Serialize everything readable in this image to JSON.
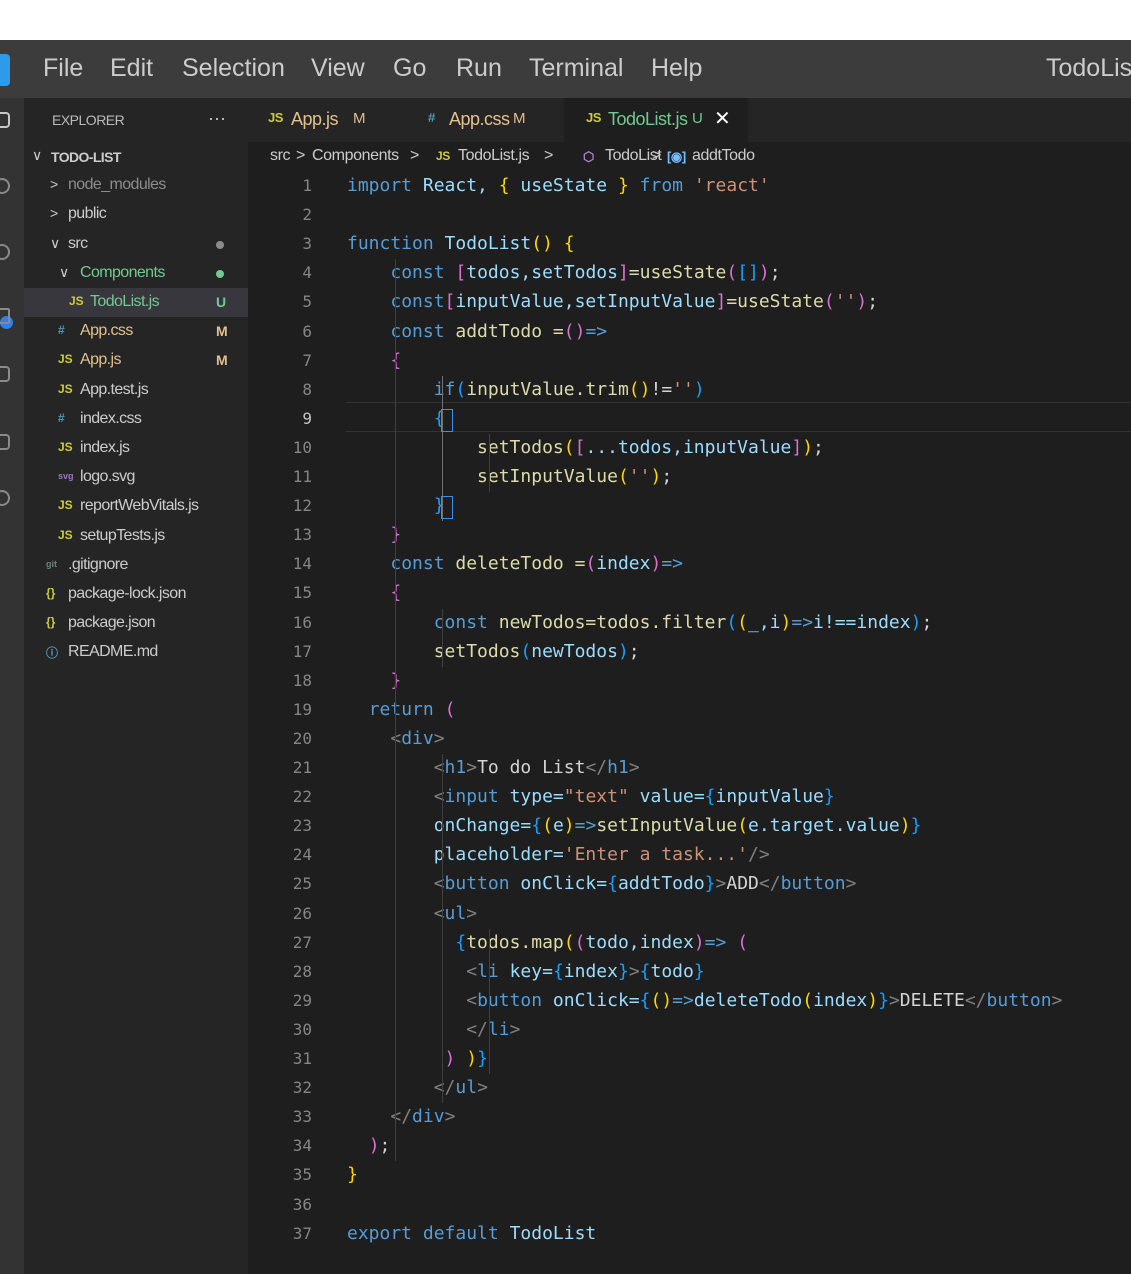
{
  "menu": {
    "items": [
      "File",
      "Edit",
      "Selection",
      "View",
      "Go",
      "Run",
      "Terminal",
      "Help"
    ],
    "window_title": "TodoList"
  },
  "explorer": {
    "title": "EXPLORER",
    "more": "···",
    "project": "TODO-LIST",
    "items": [
      {
        "name": "node_modules",
        "color": "#8c8c8c"
      },
      {
        "name": "public",
        "color": "#cccccc"
      },
      {
        "name": "src",
        "color": "#cccccc"
      },
      {
        "name": "Components",
        "color": "#73c991"
      },
      {
        "name": "TodoList.js",
        "icon": "JS",
        "status": "U",
        "color": "#73c991"
      },
      {
        "name": "App.css",
        "icon": "#",
        "status": "M",
        "color": "#e2c08d"
      },
      {
        "name": "App.js",
        "icon": "JS",
        "status": "M",
        "color": "#e2c08d"
      },
      {
        "name": "App.test.js",
        "icon": "JS",
        "color": "#cccccc"
      },
      {
        "name": "index.css",
        "icon": "#",
        "color": "#cccccc"
      },
      {
        "name": "index.js",
        "icon": "JS",
        "color": "#cccccc"
      },
      {
        "name": "logo.svg",
        "icon": "svg",
        "color": "#cccccc"
      },
      {
        "name": "reportWebVitals.js",
        "icon": "JS",
        "color": "#cccccc"
      },
      {
        "name": "setupTests.js",
        "icon": "JS",
        "color": "#cccccc"
      },
      {
        "name": ".gitignore",
        "icon": "git",
        "color": "#cccccc"
      },
      {
        "name": "package-lock.json",
        "icon": "{}",
        "color": "#cccccc"
      },
      {
        "name": "package.json",
        "icon": "{}",
        "color": "#cccccc"
      },
      {
        "name": "README.md",
        "icon": "ⓘ",
        "color": "#cccccc"
      }
    ]
  },
  "tabs": [
    {
      "icon": "JS",
      "label": "App.js",
      "status": "M"
    },
    {
      "icon": "#",
      "label": "App.css",
      "status": "M"
    },
    {
      "icon": "JS",
      "label": "TodoList.js",
      "status": "U",
      "close": "✕"
    }
  ],
  "breadcrumb": {
    "parts": [
      "src",
      "Components",
      "TodoList.js",
      "TodoList",
      "addtTodo"
    ],
    "separator": ">"
  },
  "editor": {
    "active_line": 9,
    "line_numbers": [
      "1",
      "2",
      "3",
      "4",
      "5",
      "6",
      "7",
      "8",
      "9",
      "10",
      "11",
      "12",
      "13",
      "14",
      "15",
      "16",
      "17",
      "18",
      "19",
      "20",
      "21",
      "22",
      "23",
      "24",
      "25",
      "26",
      "27",
      "28",
      "29",
      "30",
      "31",
      "32",
      "33",
      "34",
      "35",
      "36",
      "37"
    ],
    "colors": {
      "keyword": "#569cd6",
      "control": "#c586c0",
      "function": "#dcdcaa",
      "variable": "#9cdcfe",
      "string": "#ce9178",
      "tag": "#808080",
      "bracket1": "#ffd700",
      "bracket2": "#da70d6",
      "bracket3": "#179fff"
    },
    "lines": [
      [
        [
          "import",
          "k"
        ],
        [
          " React, ",
          "n"
        ],
        [
          "{",
          "b1"
        ],
        [
          " useState ",
          "n"
        ],
        [
          "}",
          "b1"
        ],
        [
          " ",
          "n"
        ],
        [
          "from",
          "k"
        ],
        [
          " ",
          "n"
        ],
        [
          "'react'",
          "s"
        ]
      ],
      [],
      [
        [
          "function",
          "k"
        ],
        [
          " TodoList",
          "n"
        ],
        [
          "()",
          "b1"
        ],
        [
          " ",
          "n"
        ],
        [
          "{",
          "b1"
        ]
      ],
      [
        [
          "    ",
          "n"
        ],
        [
          "const",
          "k"
        ],
        [
          " ",
          "n"
        ],
        [
          "[",
          "b2"
        ],
        [
          "todos,setTodos",
          "n"
        ],
        [
          "]",
          "b2"
        ],
        [
          "=useState",
          "n"
        ],
        [
          "(",
          "b2"
        ],
        [
          "[]",
          "b3"
        ],
        [
          ")",
          "b2"
        ],
        [
          ";",
          "n"
        ]
      ],
      [
        [
          "    ",
          "n"
        ],
        [
          "const",
          "k"
        ],
        [
          "[",
          "b2"
        ],
        [
          "inputValue,setInputValue",
          "n"
        ],
        [
          "]",
          "b2"
        ],
        [
          "=useState",
          "n"
        ],
        [
          "(",
          "b2"
        ],
        [
          "''",
          "s"
        ],
        [
          ")",
          "b2"
        ],
        [
          ";",
          "n"
        ]
      ],
      [
        [
          "    ",
          "n"
        ],
        [
          "const",
          "k"
        ],
        [
          " addtTodo =",
          "n"
        ],
        [
          "()",
          "b2"
        ],
        [
          "=>",
          "k"
        ]
      ],
      [
        [
          "    ",
          "n"
        ],
        [
          "{",
          "b2"
        ]
      ],
      [
        [
          "        ",
          "n"
        ],
        [
          "if",
          "k"
        ],
        [
          "(",
          "b3"
        ],
        [
          "inputValue.trim",
          "n"
        ],
        [
          "()",
          "b1"
        ],
        [
          "!=",
          "n"
        ],
        [
          "''",
          "s"
        ],
        [
          ")",
          "b3"
        ]
      ],
      [
        [
          "        ",
          "n"
        ],
        [
          "{",
          "b3"
        ]
      ],
      [
        [
          "            ",
          "n"
        ],
        [
          "setTodos",
          "n"
        ],
        [
          "(",
          "b1"
        ],
        [
          "[",
          "b2"
        ],
        [
          "...todos,inputValue",
          "n"
        ],
        [
          "]",
          "b2"
        ],
        [
          ")",
          "b1"
        ],
        [
          ";",
          "n"
        ]
      ],
      [
        [
          "            ",
          "n"
        ],
        [
          "setInputValue",
          "n"
        ],
        [
          "(",
          "b1"
        ],
        [
          "''",
          "s"
        ],
        [
          ")",
          "b1"
        ],
        [
          ";",
          "n"
        ]
      ],
      [
        [
          "        ",
          "n"
        ],
        [
          "}",
          "b3"
        ]
      ],
      [
        [
          "    ",
          "n"
        ],
        [
          "}",
          "b2"
        ]
      ],
      [
        [
          "    ",
          "n"
        ],
        [
          "const",
          "k"
        ],
        [
          " deleteTodo =",
          "n"
        ],
        [
          "(",
          "b2"
        ],
        [
          "index",
          "n"
        ],
        [
          ")",
          "b2"
        ],
        [
          "=>",
          "k"
        ]
      ],
      [
        [
          "    ",
          "n"
        ],
        [
          "{",
          "b2"
        ]
      ],
      [
        [
          "        ",
          "n"
        ],
        [
          "const",
          "k"
        ],
        [
          " newTodos=todos.filter",
          "n"
        ],
        [
          "(",
          "b3"
        ],
        [
          "(",
          "b1"
        ],
        [
          "_,i",
          "n"
        ],
        [
          ")",
          "b1"
        ],
        [
          "=>",
          "k"
        ],
        [
          "i!==index",
          "n"
        ],
        [
          ")",
          "b3"
        ],
        [
          ";",
          "n"
        ]
      ],
      [
        [
          "        ",
          "n"
        ],
        [
          "setTodos",
          "n"
        ],
        [
          "(",
          "b3"
        ],
        [
          "newTodos",
          "n"
        ],
        [
          ")",
          "b3"
        ],
        [
          ";",
          "n"
        ]
      ],
      [
        [
          "    ",
          "n"
        ],
        [
          "}",
          "b2"
        ]
      ],
      [
        [
          "  ",
          "n"
        ],
        [
          "return",
          "k"
        ],
        [
          " ",
          "n"
        ],
        [
          "(",
          "b2"
        ]
      ],
      [
        [
          "    ",
          "n"
        ],
        [
          "<",
          "t"
        ],
        [
          "div",
          "k"
        ],
        [
          ">",
          "t"
        ]
      ],
      [
        [
          "        ",
          "n"
        ],
        [
          "<",
          "t"
        ],
        [
          "h1",
          "k"
        ],
        [
          ">",
          "t"
        ],
        [
          "To do List",
          "n"
        ],
        [
          "</",
          "t"
        ],
        [
          "h1",
          "k"
        ],
        [
          ">",
          "t"
        ]
      ],
      [
        [
          "        ",
          "n"
        ],
        [
          "<",
          "t"
        ],
        [
          "input",
          "k"
        ],
        [
          " type=",
          "n"
        ],
        [
          "\"text\"",
          "s"
        ],
        [
          " value=",
          "n"
        ],
        [
          "{",
          "b3"
        ],
        [
          "inputValue",
          "n"
        ],
        [
          "}",
          "b3"
        ]
      ],
      [
        [
          "        ",
          "n"
        ],
        [
          "onChange=",
          "n"
        ],
        [
          "{",
          "b3"
        ],
        [
          "(",
          "b1"
        ],
        [
          "e",
          "n"
        ],
        [
          ")",
          "b1"
        ],
        [
          "=>",
          "k"
        ],
        [
          "setInputValue",
          "n"
        ],
        [
          "(",
          "b1"
        ],
        [
          "e.target.value",
          "n"
        ],
        [
          ")",
          "b1"
        ],
        [
          "}",
          "b3"
        ]
      ],
      [
        [
          "        ",
          "n"
        ],
        [
          "placeholder=",
          "n"
        ],
        [
          "'Enter a task...'",
          "s"
        ],
        [
          "/>",
          "t"
        ]
      ],
      [
        [
          "        ",
          "n"
        ],
        [
          "<",
          "t"
        ],
        [
          "button",
          "k"
        ],
        [
          " onClick=",
          "n"
        ],
        [
          "{",
          "b3"
        ],
        [
          "addtTodo",
          "n"
        ],
        [
          "}",
          "b3"
        ],
        [
          ">",
          "t"
        ],
        [
          "ADD",
          "n"
        ],
        [
          "</",
          "t"
        ],
        [
          "button",
          "k"
        ],
        [
          ">",
          "t"
        ]
      ],
      [
        [
          "        ",
          "n"
        ],
        [
          "<",
          "t"
        ],
        [
          "ul",
          "k"
        ],
        [
          ">",
          "t"
        ]
      ],
      [
        [
          "          ",
          "n"
        ],
        [
          "{",
          "b3"
        ],
        [
          "todos.map",
          "n"
        ],
        [
          "(",
          "b1"
        ],
        [
          "(",
          "b2"
        ],
        [
          "todo,index",
          "n"
        ],
        [
          ")",
          "b2"
        ],
        [
          "=>",
          "k"
        ],
        [
          " ",
          "n"
        ],
        [
          "(",
          "b2"
        ]
      ],
      [
        [
          "           ",
          "n"
        ],
        [
          "<",
          "t"
        ],
        [
          "li",
          "k"
        ],
        [
          " key=",
          "n"
        ],
        [
          "{",
          "b3"
        ],
        [
          "index",
          "n"
        ],
        [
          "}",
          "b3"
        ],
        [
          ">",
          "t"
        ],
        [
          "{",
          "b3"
        ],
        [
          "todo",
          "n"
        ],
        [
          "}",
          "b3"
        ]
      ],
      [
        [
          "           ",
          "n"
        ],
        [
          "<",
          "t"
        ],
        [
          "button",
          "k"
        ],
        [
          " onClick=",
          "n"
        ],
        [
          "{",
          "b3"
        ],
        [
          "()",
          "b1"
        ],
        [
          "=>",
          "k"
        ],
        [
          "deleteTodo",
          "n"
        ],
        [
          "(",
          "b1"
        ],
        [
          "index",
          "n"
        ],
        [
          ")",
          "b1"
        ],
        [
          "}",
          "b3"
        ],
        [
          ">",
          "t"
        ],
        [
          "DELETE",
          "n"
        ],
        [
          "</",
          "t"
        ],
        [
          "button",
          "k"
        ],
        [
          ">",
          "t"
        ]
      ],
      [
        [
          "           ",
          "n"
        ],
        [
          "</",
          "t"
        ],
        [
          "li",
          "k"
        ],
        [
          ">",
          "t"
        ]
      ],
      [
        [
          "         ",
          "n"
        ],
        [
          ")",
          "b2"
        ],
        [
          " ",
          "n"
        ],
        [
          ")",
          "b1"
        ],
        [
          "}",
          "b3"
        ]
      ],
      [
        [
          "        ",
          "n"
        ],
        [
          "</",
          "t"
        ],
        [
          "ul",
          "k"
        ],
        [
          ">",
          "t"
        ]
      ],
      [
        [
          "    ",
          "n"
        ],
        [
          "</",
          "t"
        ],
        [
          "div",
          "k"
        ],
        [
          ">",
          "t"
        ]
      ],
      [
        [
          "  ",
          "n"
        ],
        [
          ")",
          "b2"
        ],
        [
          ";",
          "n"
        ]
      ],
      [
        [
          "}",
          "b1"
        ]
      ],
      [],
      [
        [
          "export",
          "k"
        ],
        [
          " ",
          "n"
        ],
        [
          "default",
          "k"
        ],
        [
          " TodoList",
          "n"
        ]
      ]
    ]
  }
}
